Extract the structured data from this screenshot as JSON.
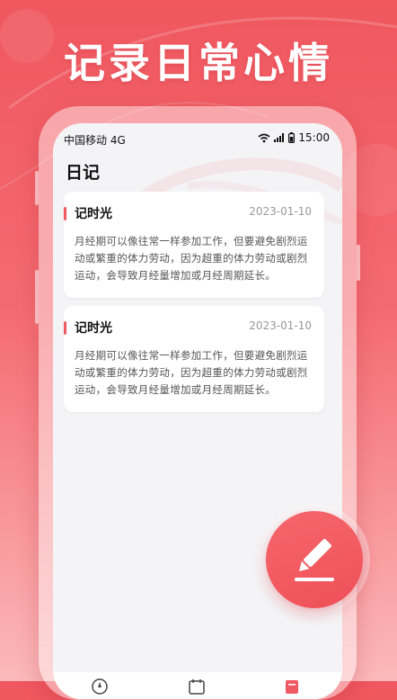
{
  "headline": "记录日常心情",
  "status_bar": {
    "carrier": "中国移动 4G",
    "time": "15:00"
  },
  "page_title": "日记",
  "entries": [
    {
      "title": "记时光",
      "date": "2023-01-10",
      "body": "月经期可以像往常一样参加工作，但要避免剧烈运动或繁重的体力劳动，因为超重的体力劳动或剧烈运动，会导致月经量增加或月经周期延长。"
    },
    {
      "title": "记时光",
      "date": "2023-01-10",
      "body": "月经期可以像往常一样参加工作，但要避免剧烈运动或繁重的体力劳动，因为超重的体力劳动或剧烈运动，会导致月经量增加或月经周期延长。"
    }
  ],
  "fab_icon": "pencil-icon",
  "tab_icons": [
    "compass-icon",
    "calendar-icon",
    "diary-icon"
  ],
  "colors": {
    "accent": "#ef5a62",
    "background_top": "#f0575f",
    "card": "#ffffff"
  }
}
